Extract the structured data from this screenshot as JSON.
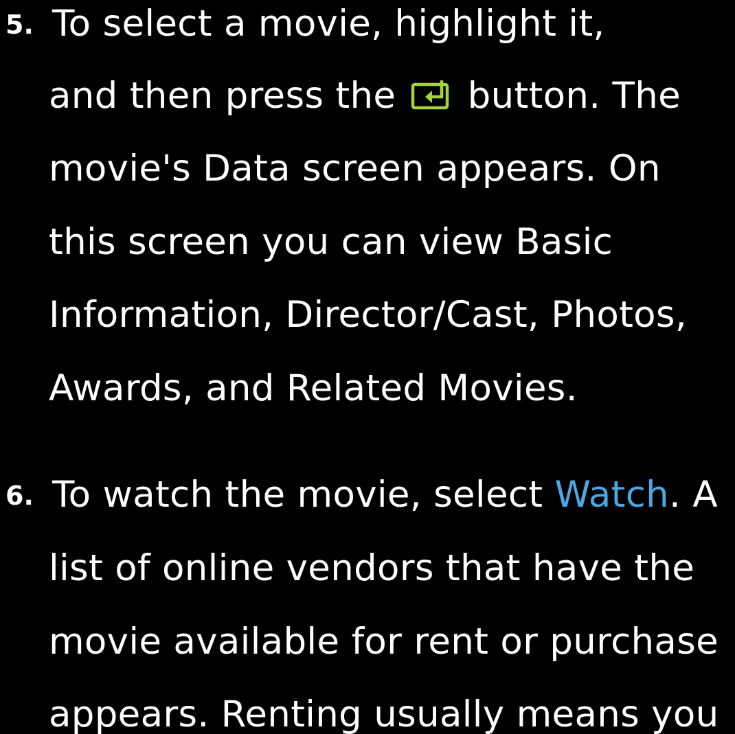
{
  "steps": [
    {
      "number": "5.",
      "lines": {
        "l1": "To select a movie, highlight it,",
        "l2_before": "and then press the",
        "l2_after": "button. The",
        "l3": "movie's Data screen appears. On",
        "l4": "this screen you can view Basic",
        "l5": "Information, Director/Cast, Photos,",
        "l6": "Awards, and Related Movies."
      },
      "icon": "enter-button-icon"
    },
    {
      "number": "6.",
      "lines": {
        "l1_before": "To watch the movie, select",
        "l1_keyword": "Watch",
        "l1_after": ". A",
        "l2": "list of online vendors that have the",
        "l3": "movie available for rent or purchase",
        "l4": "appears. Renting usually means you"
      }
    }
  ],
  "colors": {
    "background": "#000000",
    "text": "#ffffff",
    "keyword": "#4aa9e4",
    "icon": "#a6d53b"
  }
}
